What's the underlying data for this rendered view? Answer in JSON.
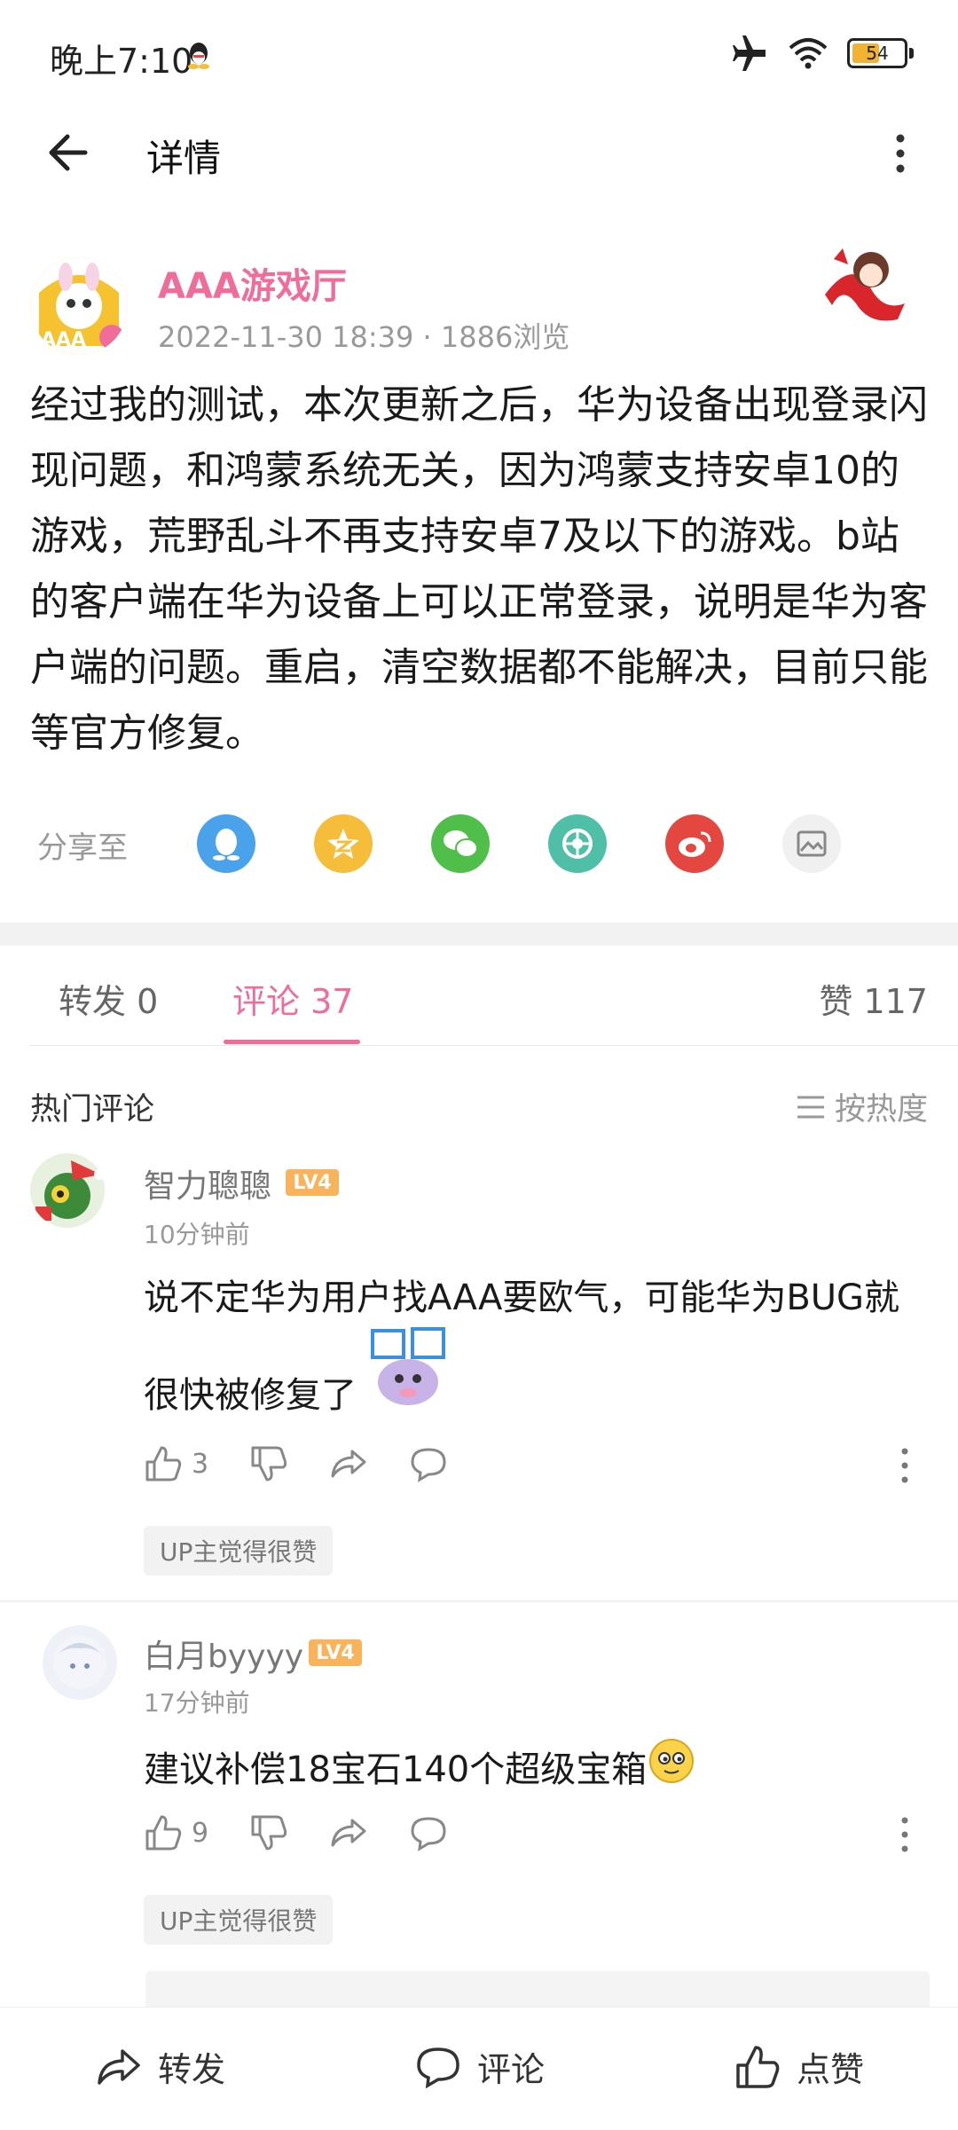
{
  "status_bar": {
    "time": "晚上7:10",
    "battery": "54"
  },
  "nav": {
    "title": "详情"
  },
  "post": {
    "author": "AAA游戏厅",
    "meta": "2022-11-30 18:39 · 1886浏览",
    "avatar_label": "AAA",
    "body": "经过我的测试，本次更新之后，华为设备出现登录闪现问题，和鸿蒙系统无关，因为鸿蒙支持安卓10的游戏，荒野乱斗不再支持安卓7及以下的游戏。b站的客户端在华为设备上可以正常登录，说明是华为客户端的问题。重启，清空数据都不能解决，目前只能等官方修复。"
  },
  "share": {
    "label": "分享至",
    "targets": [
      {
        "icon": "qq-icon",
        "color": "#4aa3ea"
      },
      {
        "icon": "qzone-icon",
        "color": "#f6bd3a"
      },
      {
        "icon": "wechat-icon",
        "color": "#4fbf4a"
      },
      {
        "icon": "moments-icon",
        "color": "#4fbfa7"
      },
      {
        "icon": "weibo-icon",
        "color": "#e4473f"
      },
      {
        "icon": "save-image-icon",
        "color": "#f0f0f0"
      }
    ]
  },
  "tabs": {
    "repost": "转发 0",
    "comments": "评论 37",
    "likes": "赞 117"
  },
  "comments_header": {
    "title": "热门评论",
    "sort": "按热度"
  },
  "comments": [
    {
      "name": "智力聰聰",
      "level": "LV4",
      "time": "10分钟前",
      "text_line1": "说不定华为用户找AAA要欧气，可能华为BUG就",
      "text_line2": "很快被修复了",
      "likes": "3",
      "tag": "UP主觉得很赞"
    },
    {
      "name": "白月byyyy",
      "level": "LV4",
      "time": "17分钟前",
      "text_line1": "建议补偿18宝石140个超级宝箱",
      "likes": "9",
      "tag": "UP主觉得很赞"
    }
  ],
  "bottom_bar": {
    "repost": "转发",
    "comment": "评论",
    "like": "点赞"
  },
  "colors": {
    "accent": "#f06c9b",
    "level": "#f9b35c"
  }
}
